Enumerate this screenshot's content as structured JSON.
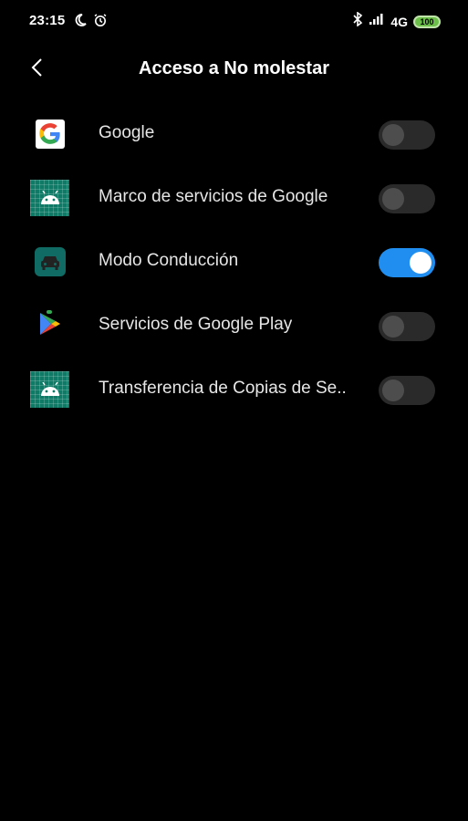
{
  "status_bar": {
    "time": "23:15",
    "network": "4G",
    "battery": "100",
    "left_icons": [
      "moon-icon",
      "alarm-icon"
    ],
    "right_icons": [
      "bluetooth-icon",
      "signal-icon"
    ]
  },
  "header": {
    "title": "Acceso a No molestar",
    "back_icon": "chevron-left-icon"
  },
  "apps": [
    {
      "label": "Google",
      "icon": "google-icon",
      "enabled": false
    },
    {
      "label": "Marco de servicios de Google",
      "icon": "android-icon",
      "enabled": false
    },
    {
      "label": "Modo Conducción",
      "icon": "car-icon",
      "enabled": true
    },
    {
      "label": "Servicios de Google Play",
      "icon": "play-services-icon",
      "enabled": false
    },
    {
      "label": "Transferencia de Copias de Se..",
      "icon": "android-icon",
      "enabled": false
    }
  ],
  "colors": {
    "background": "#000000",
    "toggle_on": "#1f8ef0",
    "toggle_off": "#2a2a2a"
  }
}
